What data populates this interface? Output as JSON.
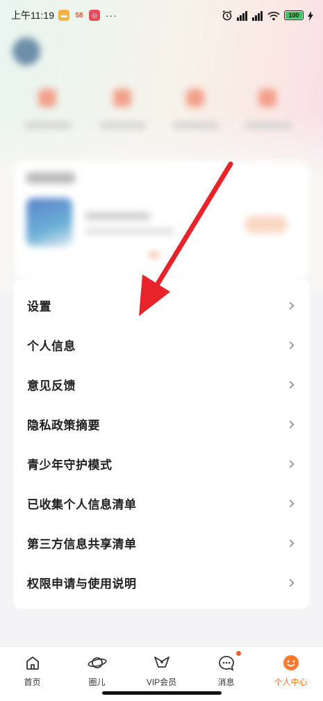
{
  "status_bar": {
    "time": "上午11:19",
    "app_badge": "58",
    "more": "···",
    "network": "HD",
    "battery": "100"
  },
  "menu": {
    "items": [
      {
        "label": "设置"
      },
      {
        "label": "个人信息"
      },
      {
        "label": "意见反馈"
      },
      {
        "label": "隐私政策摘要"
      },
      {
        "label": "青少年守护模式"
      },
      {
        "label": "已收集个人信息清单"
      },
      {
        "label": "第三方信息共享清单"
      },
      {
        "label": "权限申请与使用说明"
      }
    ]
  },
  "tabbar": {
    "tabs": [
      {
        "label": "首页",
        "icon": "home-icon"
      },
      {
        "label": "圈儿",
        "icon": "planet-icon"
      },
      {
        "label": "VIP会员",
        "icon": "bowtie-icon"
      },
      {
        "label": "消息",
        "icon": "chat-icon"
      },
      {
        "label": "个人中心",
        "icon": "smile-icon"
      }
    ],
    "active": "个人中心"
  },
  "colors": {
    "accent": "#ff7a2f",
    "arrow": "#e8232a",
    "badge": "#ff5a2c"
  }
}
